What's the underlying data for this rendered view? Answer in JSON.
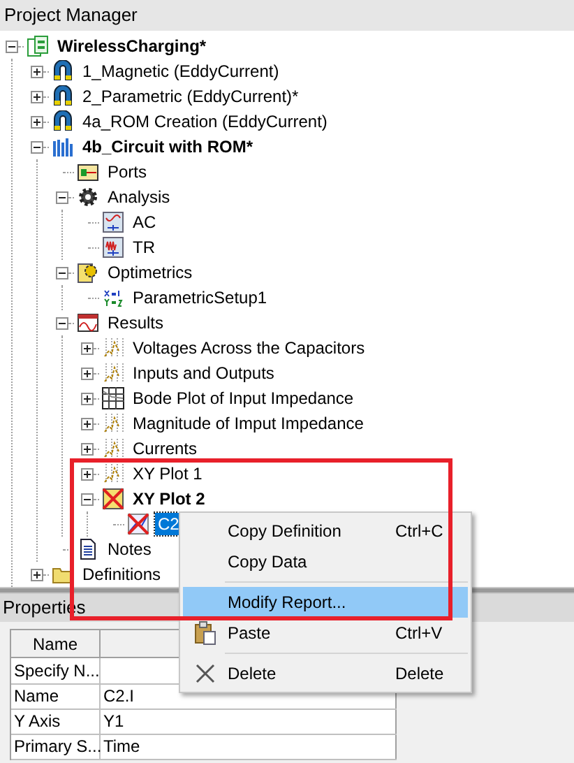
{
  "panel_title": "Project Manager",
  "tree": [
    {
      "label": "WirelessCharging*",
      "kind": "project",
      "bold": true,
      "selected": false,
      "expanded": true,
      "children": [
        {
          "label": "1_Magnetic (EddyCurrent)",
          "kind": "design",
          "bold": false,
          "selected": false,
          "expanded": false
        },
        {
          "label": "2_Parametric (EddyCurrent)*",
          "kind": "design",
          "bold": false,
          "selected": false,
          "expanded": false
        },
        {
          "label": "4a_ROM Creation (EddyCurrent)",
          "kind": "design",
          "bold": false,
          "selected": false,
          "expanded": false
        },
        {
          "label": "4b_Circuit with ROM*",
          "kind": "circuit",
          "bold": true,
          "selected": false,
          "expanded": true,
          "children": [
            {
              "label": "Ports",
              "kind": "ports",
              "bold": false,
              "selected": false
            },
            {
              "label": "Analysis",
              "kind": "analysis",
              "bold": false,
              "selected": false,
              "expanded": true,
              "children": [
                {
                  "label": "AC",
                  "kind": "ac-setup",
                  "bold": false,
                  "selected": false
                },
                {
                  "label": "TR",
                  "kind": "tr-setup",
                  "bold": false,
                  "selected": false
                }
              ]
            },
            {
              "label": "Optimetrics",
              "kind": "optimetrics",
              "bold": false,
              "selected": false,
              "expanded": true,
              "children": [
                {
                  "label": "ParametricSetup1",
                  "kind": "parametric",
                  "bold": false,
                  "selected": false
                }
              ]
            },
            {
              "label": "Results",
              "kind": "results",
              "bold": false,
              "selected": false,
              "expanded": true,
              "children": [
                {
                  "label": "Voltages Across the Capacitors",
                  "kind": "report",
                  "bold": false,
                  "selected": false,
                  "expanded": false
                },
                {
                  "label": "Inputs and Outputs",
                  "kind": "report",
                  "bold": false,
                  "selected": false,
                  "expanded": false
                },
                {
                  "label": "Bode Plot of Input Impedance",
                  "kind": "bode",
                  "bold": false,
                  "selected": false,
                  "expanded": false
                },
                {
                  "label": "Magnitude of Imput Impedance",
                  "kind": "report",
                  "bold": false,
                  "selected": false,
                  "expanded": false
                },
                {
                  "label": "Currents",
                  "kind": "report",
                  "bold": false,
                  "selected": false,
                  "expanded": false
                },
                {
                  "label": "XY Plot 1",
                  "kind": "report",
                  "bold": false,
                  "selected": false,
                  "expanded": false
                },
                {
                  "label": "XY Plot 2",
                  "kind": "invalid-report",
                  "bold": true,
                  "selected": false,
                  "expanded": true,
                  "children": [
                    {
                      "label": "C2",
                      "kind": "invalid-trace",
                      "bold": false,
                      "selected": true
                    }
                  ]
                }
              ]
            },
            {
              "label": "Notes",
              "kind": "notes",
              "bold": false,
              "selected": false
            }
          ]
        },
        {
          "label": "Definitions",
          "kind": "folder",
          "bold": false,
          "selected": false,
          "expanded": false
        }
      ]
    }
  ],
  "context_menu": [
    {
      "kind": "command",
      "label": "Copy Definition",
      "shortcut": "Ctrl+C",
      "selected": false
    },
    {
      "kind": "command",
      "label": "Copy Data",
      "selected": false
    },
    {
      "kind": "separator"
    },
    {
      "kind": "command",
      "label": "Modify Report...",
      "selected": true
    },
    {
      "kind": "paste",
      "label": "Paste",
      "shortcut": "Ctrl+V",
      "selected": false
    },
    {
      "kind": "separator"
    },
    {
      "kind": "delete",
      "label": "Delete",
      "shortcut": "Delete",
      "selected": false
    }
  ],
  "properties": {
    "title": "Properties",
    "column_1": "Name",
    "rows": [
      {
        "name": "Specify N..."
      },
      {
        "name": "Name",
        "value": "C2.I"
      },
      {
        "name": "Y Axis",
        "value": "Y1"
      },
      {
        "name": "Primary S...",
        "value": "Time"
      }
    ]
  }
}
